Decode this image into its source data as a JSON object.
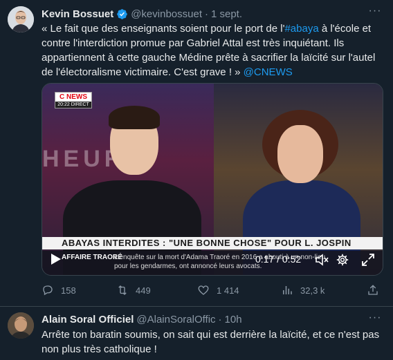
{
  "tweet": {
    "author_name": "Kevin Bossuet",
    "handle": "@kevinbossuet",
    "separator": "·",
    "time": "1 sept.",
    "more_label": "···",
    "text_before_hashtag": "« Le fait que des enseignants soient pour le port de l'",
    "hashtag": "#abaya",
    "text_after_hashtag": " à l'école et contre l'interdiction promue par Gabriel Attal est très inquiétant. Ils appartiennent à cette gauche Médine prête à sacrifier la laïcité sur l'autel de l'électoralisme victimaire. C'est grave ! »",
    "mention": " @CNEWS",
    "video": {
      "channel_logo": "C NEWS",
      "channel_time": "20:22 DIRECT",
      "backdrop_word": "HEURE",
      "banner": "ABAYAS INTERDITES : \"UNE BONNE CHOSE\" POUR L. JOSPIN",
      "ticker_tag": "AFFAIRE TRAORÉ",
      "ticker_text": "L'enquête sur la mort d'Adama Traoré en 2016 a abouti à un non-lieu pour les gendarmes, ont annoncé leurs avocats.",
      "time": "0:17 / 0:52"
    },
    "stats": {
      "replies": "158",
      "retweets": "449",
      "likes": "1 414",
      "views": "32,3 k"
    },
    "colors": {
      "background": "#15202b",
      "accent": "#1d9bf0",
      "muted": "#8b98a5"
    }
  },
  "reply": {
    "author_name": "Alain Soral Officiel",
    "handle": "@AlainSoralOffic",
    "separator": "·",
    "time": "10h",
    "more_label": "···",
    "text": "Arrête ton baratin soumis, on sait qui est derrière la laïcité, et ce n'est pas non plus très catholique !"
  }
}
